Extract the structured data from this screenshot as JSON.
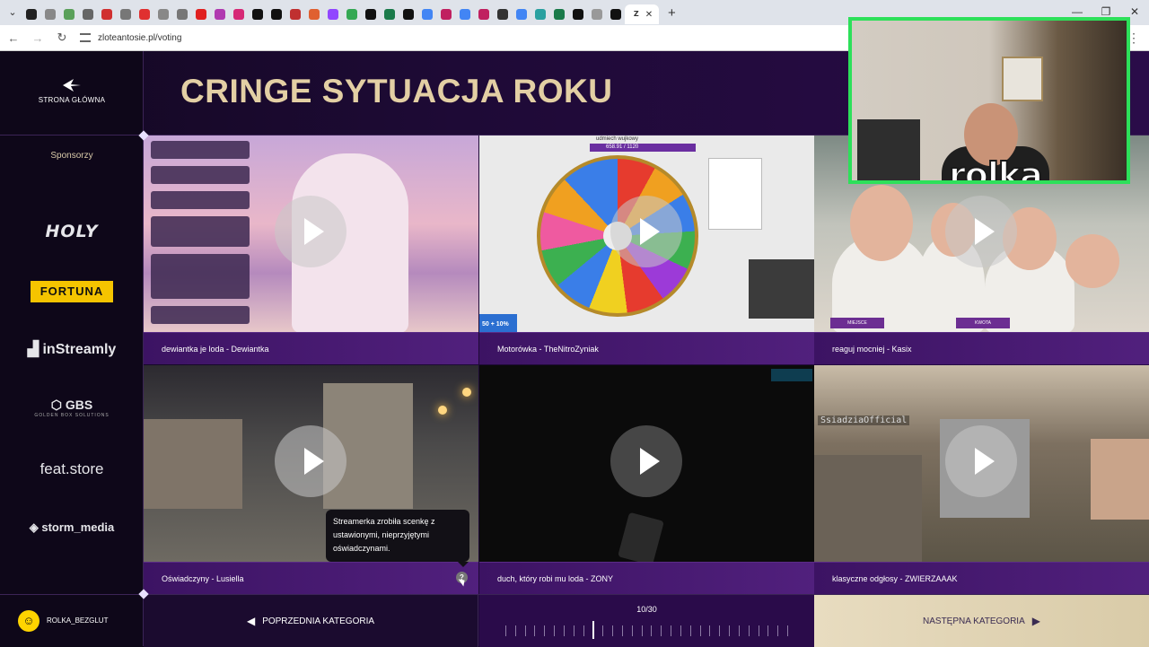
{
  "browser": {
    "url": "zloteantosie.pl/voting",
    "tabs": [
      {
        "icon": "tab-favicon",
        "color": "#222"
      },
      {
        "icon": "tab-favicon",
        "color": "#888"
      },
      {
        "icon": "tab-favicon",
        "color": "#5aa05a"
      },
      {
        "icon": "tab-favicon",
        "color": "#666"
      },
      {
        "icon": "tab-favicon",
        "color": "#d03030"
      },
      {
        "icon": "tab-favicon",
        "color": "#777"
      },
      {
        "icon": "tab-favicon",
        "color": "#e03030"
      },
      {
        "icon": "tab-favicon",
        "color": "#888"
      },
      {
        "icon": "tab-favicon",
        "color": "#777"
      },
      {
        "icon": "tab-favicon",
        "color": "#e02020"
      },
      {
        "icon": "tab-favicon",
        "color": "#b03ab0"
      },
      {
        "icon": "tab-favicon",
        "color": "#d62976"
      },
      {
        "icon": "tab-favicon",
        "color": "#111"
      },
      {
        "icon": "tab-favicon",
        "color": "#111"
      },
      {
        "icon": "tab-favicon",
        "color": "#c03030"
      },
      {
        "icon": "tab-favicon",
        "color": "#e06030"
      },
      {
        "icon": "tab-favicon",
        "color": "#9146ff"
      },
      {
        "icon": "tab-favicon",
        "color": "#34a853"
      },
      {
        "icon": "tab-favicon",
        "color": "#111"
      },
      {
        "icon": "tab-favicon",
        "color": "#1a7a4a"
      },
      {
        "icon": "tab-favicon",
        "color": "#111"
      },
      {
        "icon": "tab-favicon",
        "color": "#4285f4"
      },
      {
        "icon": "tab-favicon",
        "color": "#c02060"
      },
      {
        "icon": "tab-favicon",
        "color": "#4285f4"
      },
      {
        "icon": "tab-favicon",
        "color": "#c02060"
      },
      {
        "icon": "tab-favicon",
        "color": "#333"
      },
      {
        "icon": "tab-favicon",
        "color": "#4285f4"
      },
      {
        "icon": "tab-favicon",
        "color": "#2aa0a0"
      },
      {
        "icon": "tab-favicon",
        "color": "#1a7a4a"
      },
      {
        "icon": "tab-favicon",
        "color": "#111"
      },
      {
        "icon": "tab-favicon",
        "color": "#999"
      },
      {
        "icon": "tab-favicon",
        "color": "#111"
      }
    ],
    "active_tab_label": "Z"
  },
  "sidebar": {
    "home_label": "STRONA GŁÓWNA",
    "sponsors_title": "Sponsorzy",
    "sponsors": [
      "HOLY",
      "FORTUNA",
      "inStreamly",
      "GBS",
      "feat.store",
      "storm_media"
    ],
    "gbs_sub": "GOLDEN BOX SOLUTIONS",
    "username": "ROLKA_BEZGLUT"
  },
  "header": {
    "title": "CRINGE SYTUACJA ROKU"
  },
  "cards": [
    {
      "caption": "dewiantka je loda - Dewiantka"
    },
    {
      "caption": "Motorówka - TheNitroZyniak"
    },
    {
      "caption": "reaguj mocniej - Kasix"
    },
    {
      "caption": "Oświadczyny - Lusiella"
    },
    {
      "caption": "duch, który robi mu loda - ZONY"
    },
    {
      "caption": "klasyczne odgłosy - ZWIERZAAAK"
    }
  ],
  "thumb_text": {
    "wheel_title": "udmiech wujkowy",
    "wheel_counter": "658.91 / 1120",
    "promo": "50 + 10%",
    "tag_left": "MIEJSCE",
    "tag_right": "KWOTA",
    "mc_name": "SsiadziaOfficial"
  },
  "tooltip": {
    "text": "Streamerka zrobiła scenkę z ustawionymi, nieprzyjętymi oświadczynami."
  },
  "info_icon": "?",
  "footer": {
    "prev_label": "POPRZEDNIA KATEGORIA",
    "next_label": "NASTĘPNA KATEGORIA",
    "counter": "10/30",
    "current": 10,
    "total": 30
  },
  "webcam": {
    "overlay_name": "rolka",
    "border_color": "#2de05a"
  },
  "colors": {
    "title_gold": "#e3cfa4",
    "accent_purple": "#51207d",
    "fortuna_yellow": "#f5c400",
    "next_button": "#e8dcc0"
  }
}
